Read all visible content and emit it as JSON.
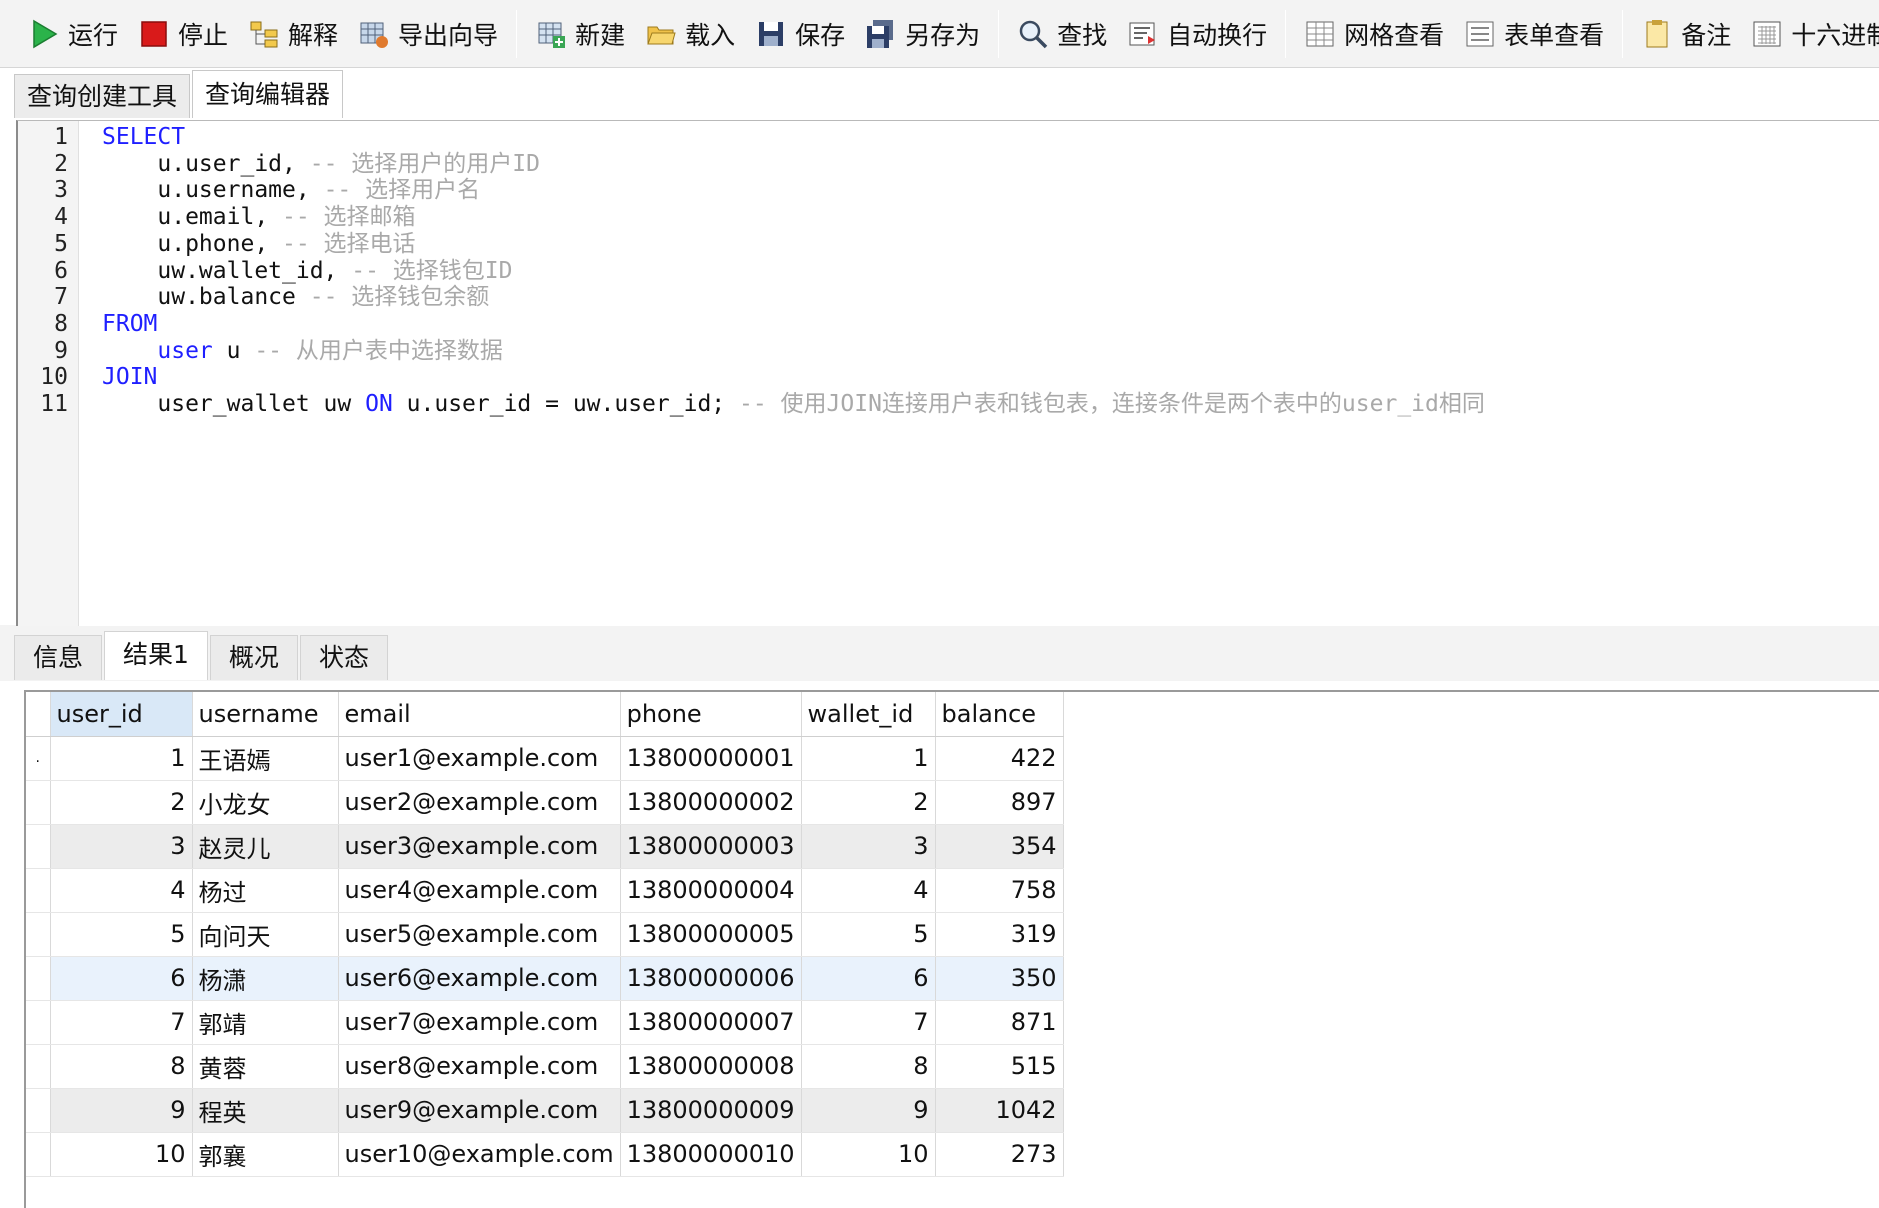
{
  "toolbar": [
    {
      "label": "运行",
      "icon": "run-icon"
    },
    {
      "label": "停止",
      "icon": "stop-icon"
    },
    {
      "label": "解释",
      "icon": "explain-icon"
    },
    {
      "label": "导出向导",
      "icon": "export-wizard-icon"
    },
    {
      "label": "新建",
      "icon": "new-icon"
    },
    {
      "label": "载入",
      "icon": "open-folder-icon"
    },
    {
      "label": "保存",
      "icon": "save-icon"
    },
    {
      "label": "另存为",
      "icon": "save-as-icon"
    },
    {
      "label": "查找",
      "icon": "search-icon"
    },
    {
      "label": "自动换行",
      "icon": "word-wrap-icon"
    },
    {
      "label": "网格查看",
      "icon": "grid-view-icon"
    },
    {
      "label": "表单查看",
      "icon": "form-view-icon"
    },
    {
      "label": "备注",
      "icon": "memo-icon"
    },
    {
      "label": "十六进制",
      "icon": "hex-icon"
    }
  ],
  "tabs": [
    {
      "label": "查询创建工具",
      "active": false
    },
    {
      "label": "查询编辑器",
      "active": true
    }
  ],
  "editor": {
    "lines": [
      {
        "n": "1",
        "tokens": [
          {
            "t": "SELECT",
            "c": "kw"
          }
        ]
      },
      {
        "n": "2",
        "tokens": [
          {
            "t": "    u.user_id, ",
            "c": ""
          },
          {
            "t": "-- 选择用户的用户ID",
            "c": "cmt"
          }
        ]
      },
      {
        "n": "3",
        "tokens": [
          {
            "t": "    u.username, ",
            "c": ""
          },
          {
            "t": "-- 选择用户名",
            "c": "cmt"
          }
        ]
      },
      {
        "n": "4",
        "tokens": [
          {
            "t": "    u.email, ",
            "c": ""
          },
          {
            "t": "-- 选择邮箱",
            "c": "cmt"
          }
        ]
      },
      {
        "n": "5",
        "tokens": [
          {
            "t": "    u.phone, ",
            "c": ""
          },
          {
            "t": "-- 选择电话",
            "c": "cmt"
          }
        ]
      },
      {
        "n": "6",
        "tokens": [
          {
            "t": "    uw.wallet_id, ",
            "c": ""
          },
          {
            "t": "-- 选择钱包ID",
            "c": "cmt"
          }
        ]
      },
      {
        "n": "7",
        "tokens": [
          {
            "t": "    uw.balance ",
            "c": ""
          },
          {
            "t": "-- 选择钱包余额",
            "c": "cmt"
          }
        ]
      },
      {
        "n": "8",
        "tokens": [
          {
            "t": "FROM",
            "c": "kw"
          }
        ]
      },
      {
        "n": "9",
        "tokens": [
          {
            "t": "    ",
            "c": ""
          },
          {
            "t": "user",
            "c": "kw"
          },
          {
            "t": " u ",
            "c": ""
          },
          {
            "t": "-- 从用户表中选择数据",
            "c": "cmt"
          }
        ]
      },
      {
        "n": "10",
        "tokens": [
          {
            "t": "JOIN",
            "c": "kw"
          }
        ]
      },
      {
        "n": "11",
        "tokens": [
          {
            "t": "    user_wallet uw ",
            "c": ""
          },
          {
            "t": "ON",
            "c": "kw"
          },
          {
            "t": " u.user_id = uw.user_id; ",
            "c": ""
          },
          {
            "t": "-- 使用JOIN连接用户表和钱包表，连接条件是两个表中的user_id相同",
            "c": "cmt"
          }
        ]
      }
    ]
  },
  "result_tabs": [
    {
      "label": "信息",
      "active": false
    },
    {
      "label": "结果1",
      "active": true
    },
    {
      "label": "概况",
      "active": false
    },
    {
      "label": "状态",
      "active": false
    }
  ],
  "grid": {
    "columns": [
      "user_id",
      "username",
      "email",
      "phone",
      "wallet_id",
      "balance"
    ],
    "rows": [
      [
        "1",
        "王语嫣",
        "user1@example.com",
        "13800000001",
        "1",
        "422"
      ],
      [
        "2",
        "小龙女",
        "user2@example.com",
        "13800000002",
        "2",
        "897"
      ],
      [
        "3",
        "赵灵儿",
        "user3@example.com",
        "13800000003",
        "3",
        "354"
      ],
      [
        "4",
        "杨过",
        "user4@example.com",
        "13800000004",
        "4",
        "758"
      ],
      [
        "5",
        "向问天",
        "user5@example.com",
        "13800000005",
        "5",
        "319"
      ],
      [
        "6",
        "杨潇",
        "user6@example.com",
        "13800000006",
        "6",
        "350"
      ],
      [
        "7",
        "郭靖",
        "user7@example.com",
        "13800000007",
        "7",
        "871"
      ],
      [
        "8",
        "黄蓉",
        "user8@example.com",
        "13800000008",
        "8",
        "515"
      ],
      [
        "9",
        "程英",
        "user9@example.com",
        "13800000009",
        "9",
        "1042"
      ],
      [
        "10",
        "郭襄",
        "user10@example.com",
        "13800000010",
        "10",
        "273"
      ]
    ]
  },
  "colors": {
    "keyword": "#1f1fff",
    "comment": "#a9a9a9",
    "selected_header": "#d9e8f7"
  }
}
